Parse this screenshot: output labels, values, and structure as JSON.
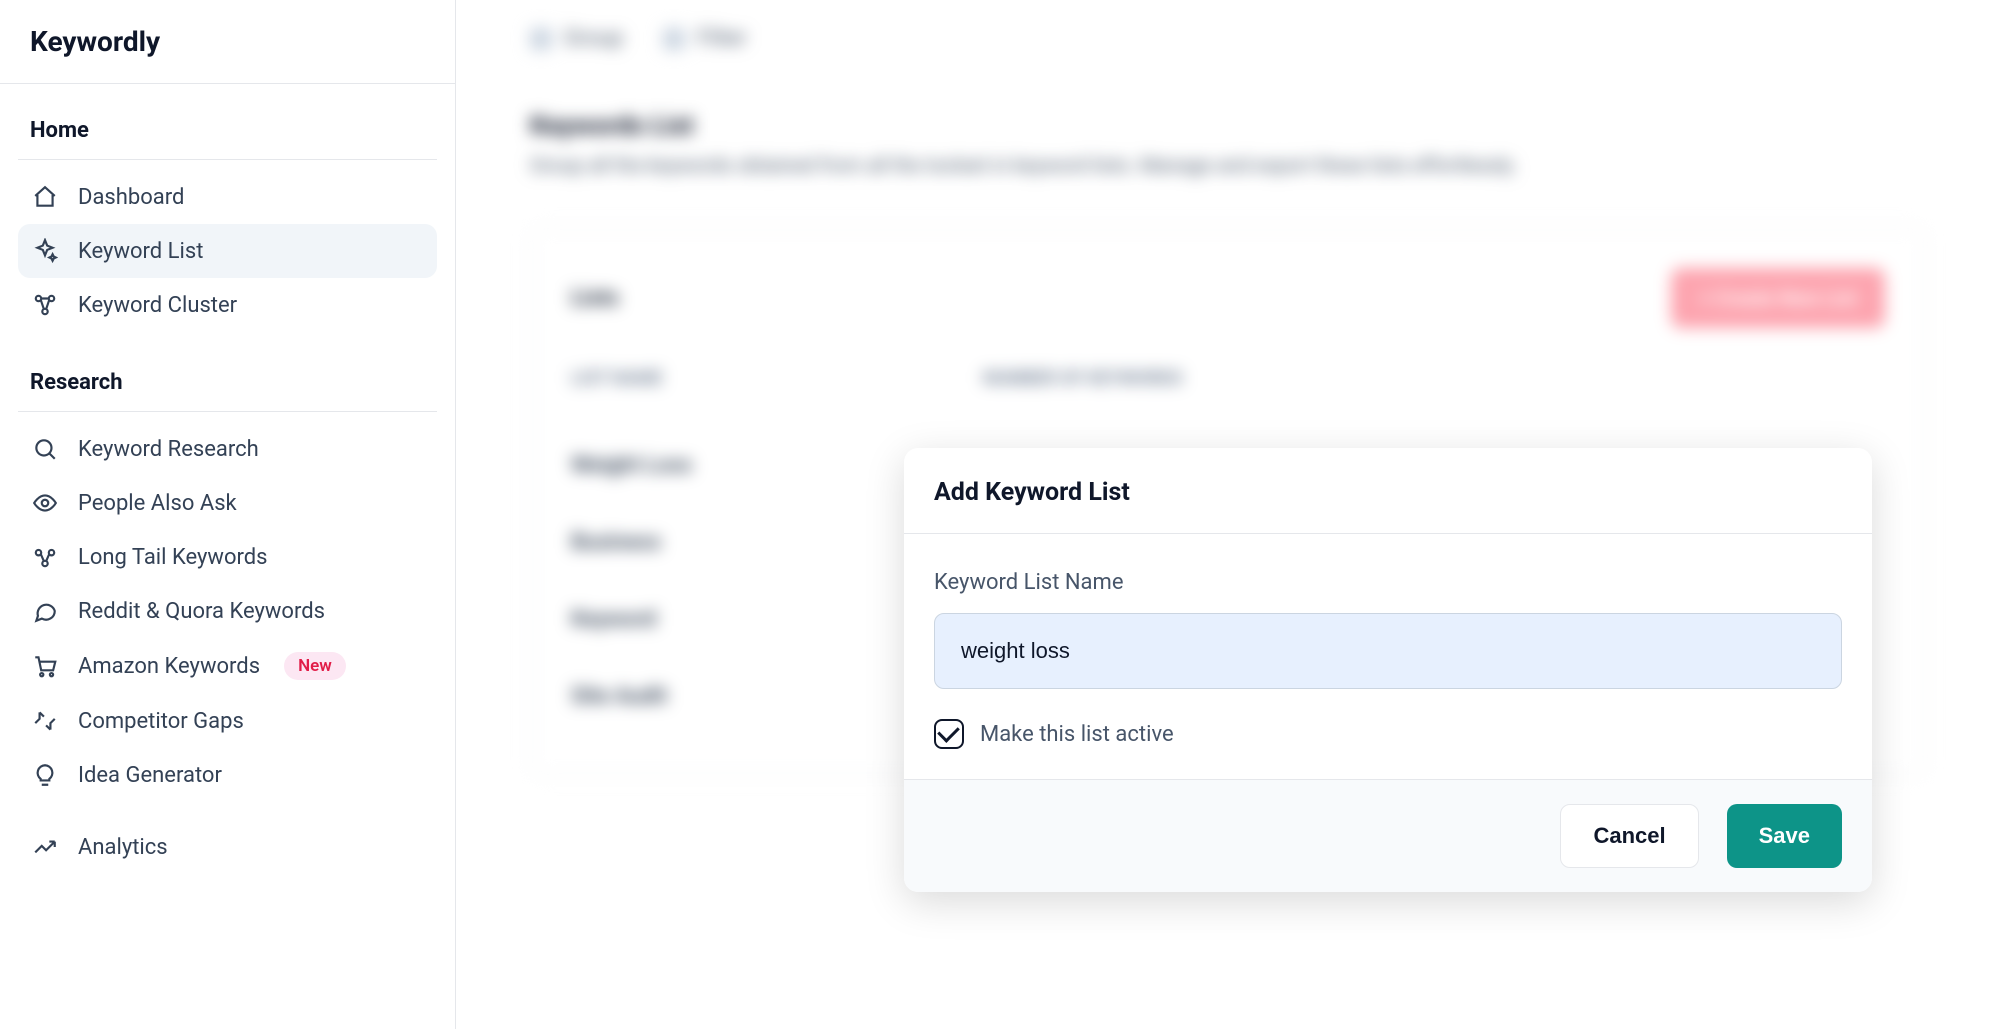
{
  "app": {
    "name": "Keywordly"
  },
  "nav": {
    "groups": [
      {
        "title": "Home",
        "items": [
          {
            "label": "Dashboard",
            "icon": "home-icon"
          },
          {
            "label": "Keyword List",
            "icon": "sparkle-icon",
            "active": true
          },
          {
            "label": "Keyword Cluster",
            "icon": "cluster-icon"
          }
        ]
      },
      {
        "title": "Research",
        "items": [
          {
            "label": "Keyword Research",
            "icon": "search-icon"
          },
          {
            "label": "People Also Ask",
            "icon": "eye-icon"
          },
          {
            "label": "Long Tail Keywords",
            "icon": "molecule-icon"
          },
          {
            "label": "Reddit & Quora Keywords",
            "icon": "chat-icon"
          },
          {
            "label": "Amazon Keywords",
            "icon": "cart-icon",
            "badge": "New"
          },
          {
            "label": "Competitor Gaps",
            "icon": "compare-icon"
          },
          {
            "label": "Idea Generator",
            "icon": "bulb-icon"
          },
          {
            "label": "Analytics",
            "icon": "trend-icon"
          }
        ]
      }
    ]
  },
  "background": {
    "toolbar": [
      {
        "label": "Group"
      },
      {
        "label": "Filter"
      }
    ],
    "page_title": "Keywords List",
    "page_desc": "Group all the keywords obtained from all the toolset in keyword lists. Manage and export these lists effortlessly.",
    "card_title": "Lists",
    "create_btn": "+ Create New List",
    "columns": [
      "LIST NAME",
      "NUMBER OF KEYWORDS"
    ],
    "rows": [
      "Weight Loss",
      "Business",
      "Keyword",
      "Site Audit"
    ]
  },
  "modal": {
    "title": "Add Keyword List",
    "field_label": "Keyword List Name",
    "field_value": "weight loss",
    "checkbox_label": "Make this list active",
    "checkbox_checked": true,
    "buttons": {
      "cancel": "Cancel",
      "save": "Save"
    }
  }
}
